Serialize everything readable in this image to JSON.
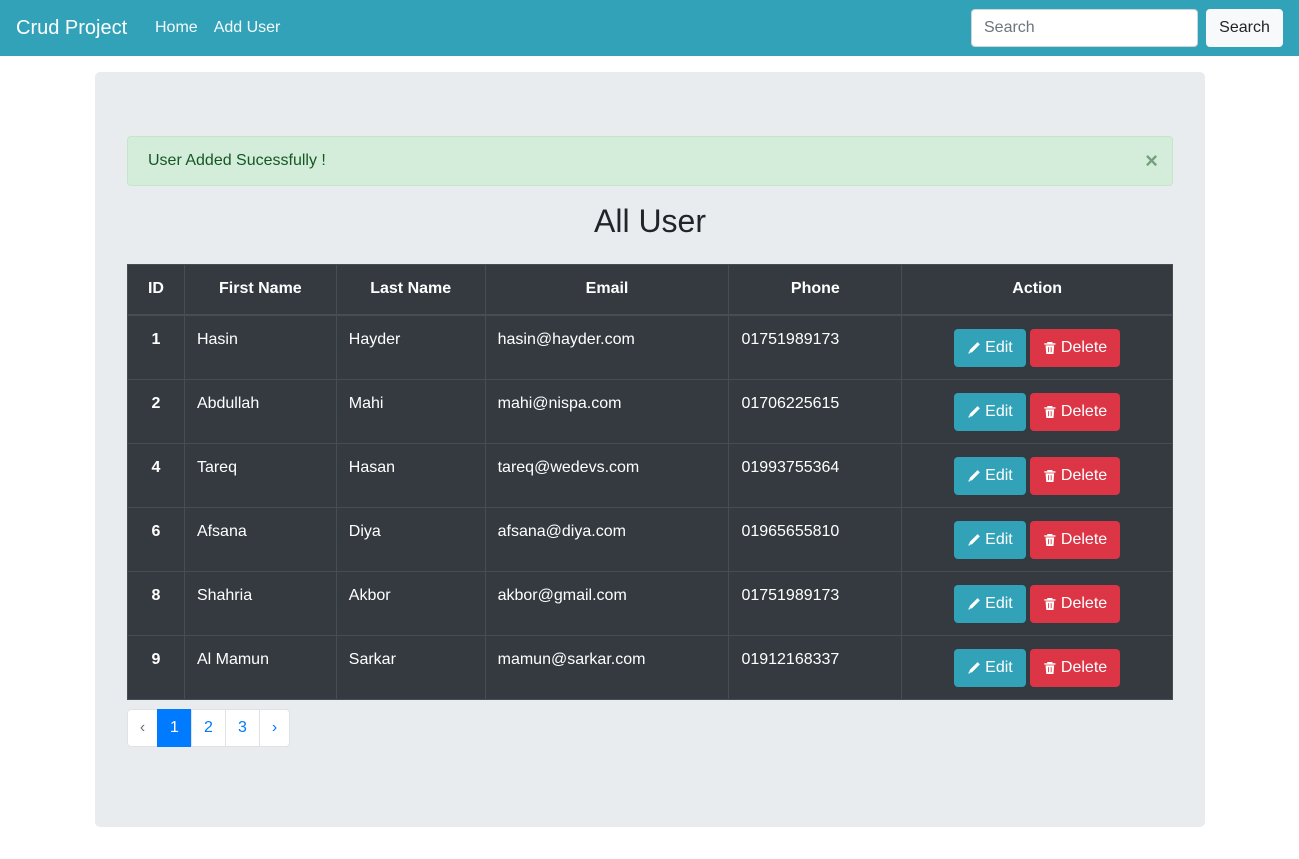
{
  "navbar": {
    "brand": "Crud Project",
    "links": [
      "Home",
      "Add User"
    ],
    "search_placeholder": "Search",
    "search_button": "Search"
  },
  "alert": {
    "message": "User Added Sucessfully !",
    "close": "×"
  },
  "title": "All User",
  "table": {
    "headers": [
      "ID",
      "First Name",
      "Last Name",
      "Email",
      "Phone",
      "Action"
    ],
    "rows": [
      {
        "id": "1",
        "first": "Hasin",
        "last": "Hayder",
        "email": "hasin@hayder.com",
        "phone": "01751989173"
      },
      {
        "id": "2",
        "first": "Abdullah",
        "last": "Mahi",
        "email": "mahi@nispa.com",
        "phone": "01706225615"
      },
      {
        "id": "4",
        "first": "Tareq",
        "last": "Hasan",
        "email": "tareq@wedevs.com",
        "phone": "01993755364"
      },
      {
        "id": "6",
        "first": "Afsana",
        "last": "Diya",
        "email": "afsana@diya.com",
        "phone": "01965655810"
      },
      {
        "id": "8",
        "first": "Shahria",
        "last": "Akbor",
        "email": "akbor@gmail.com",
        "phone": "01751989173"
      },
      {
        "id": "9",
        "first": "Al Mamun",
        "last": "Sarkar",
        "email": "mamun@sarkar.com",
        "phone": "01912168337"
      }
    ],
    "edit_label": "Edit",
    "delete_label": "Delete"
  },
  "pagination": {
    "prev": "‹",
    "pages": [
      "1",
      "2",
      "3"
    ],
    "next": "›",
    "active_page": "1"
  },
  "colors": {
    "navbar": "#31a2b8",
    "edit": "#31a2b8",
    "delete": "#dc3545",
    "table_bg": "#343a40",
    "alert_bg": "#d4edda",
    "active_page": "#007bff"
  },
  "icons": {
    "edit": "pencil-icon",
    "delete": "trash-icon",
    "close": "close-icon"
  }
}
